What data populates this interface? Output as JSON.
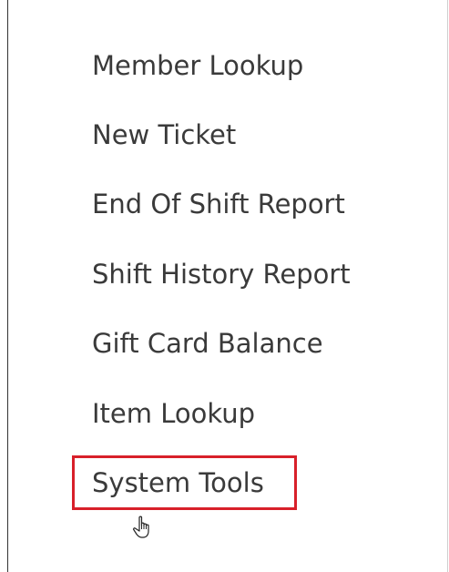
{
  "menu": {
    "items": [
      {
        "label": "Member Lookup"
      },
      {
        "label": "New Ticket"
      },
      {
        "label": "End Of Shift Report"
      },
      {
        "label": "Shift History Report"
      },
      {
        "label": "Gift Card Balance"
      },
      {
        "label": "Item Lookup"
      },
      {
        "label": "System Tools"
      }
    ],
    "highlighted_item": "System Tools"
  },
  "colors": {
    "text": "#3a3a3a",
    "highlight": "#d8202a"
  },
  "icons": {
    "cursor": "hand-pointer-icon"
  }
}
